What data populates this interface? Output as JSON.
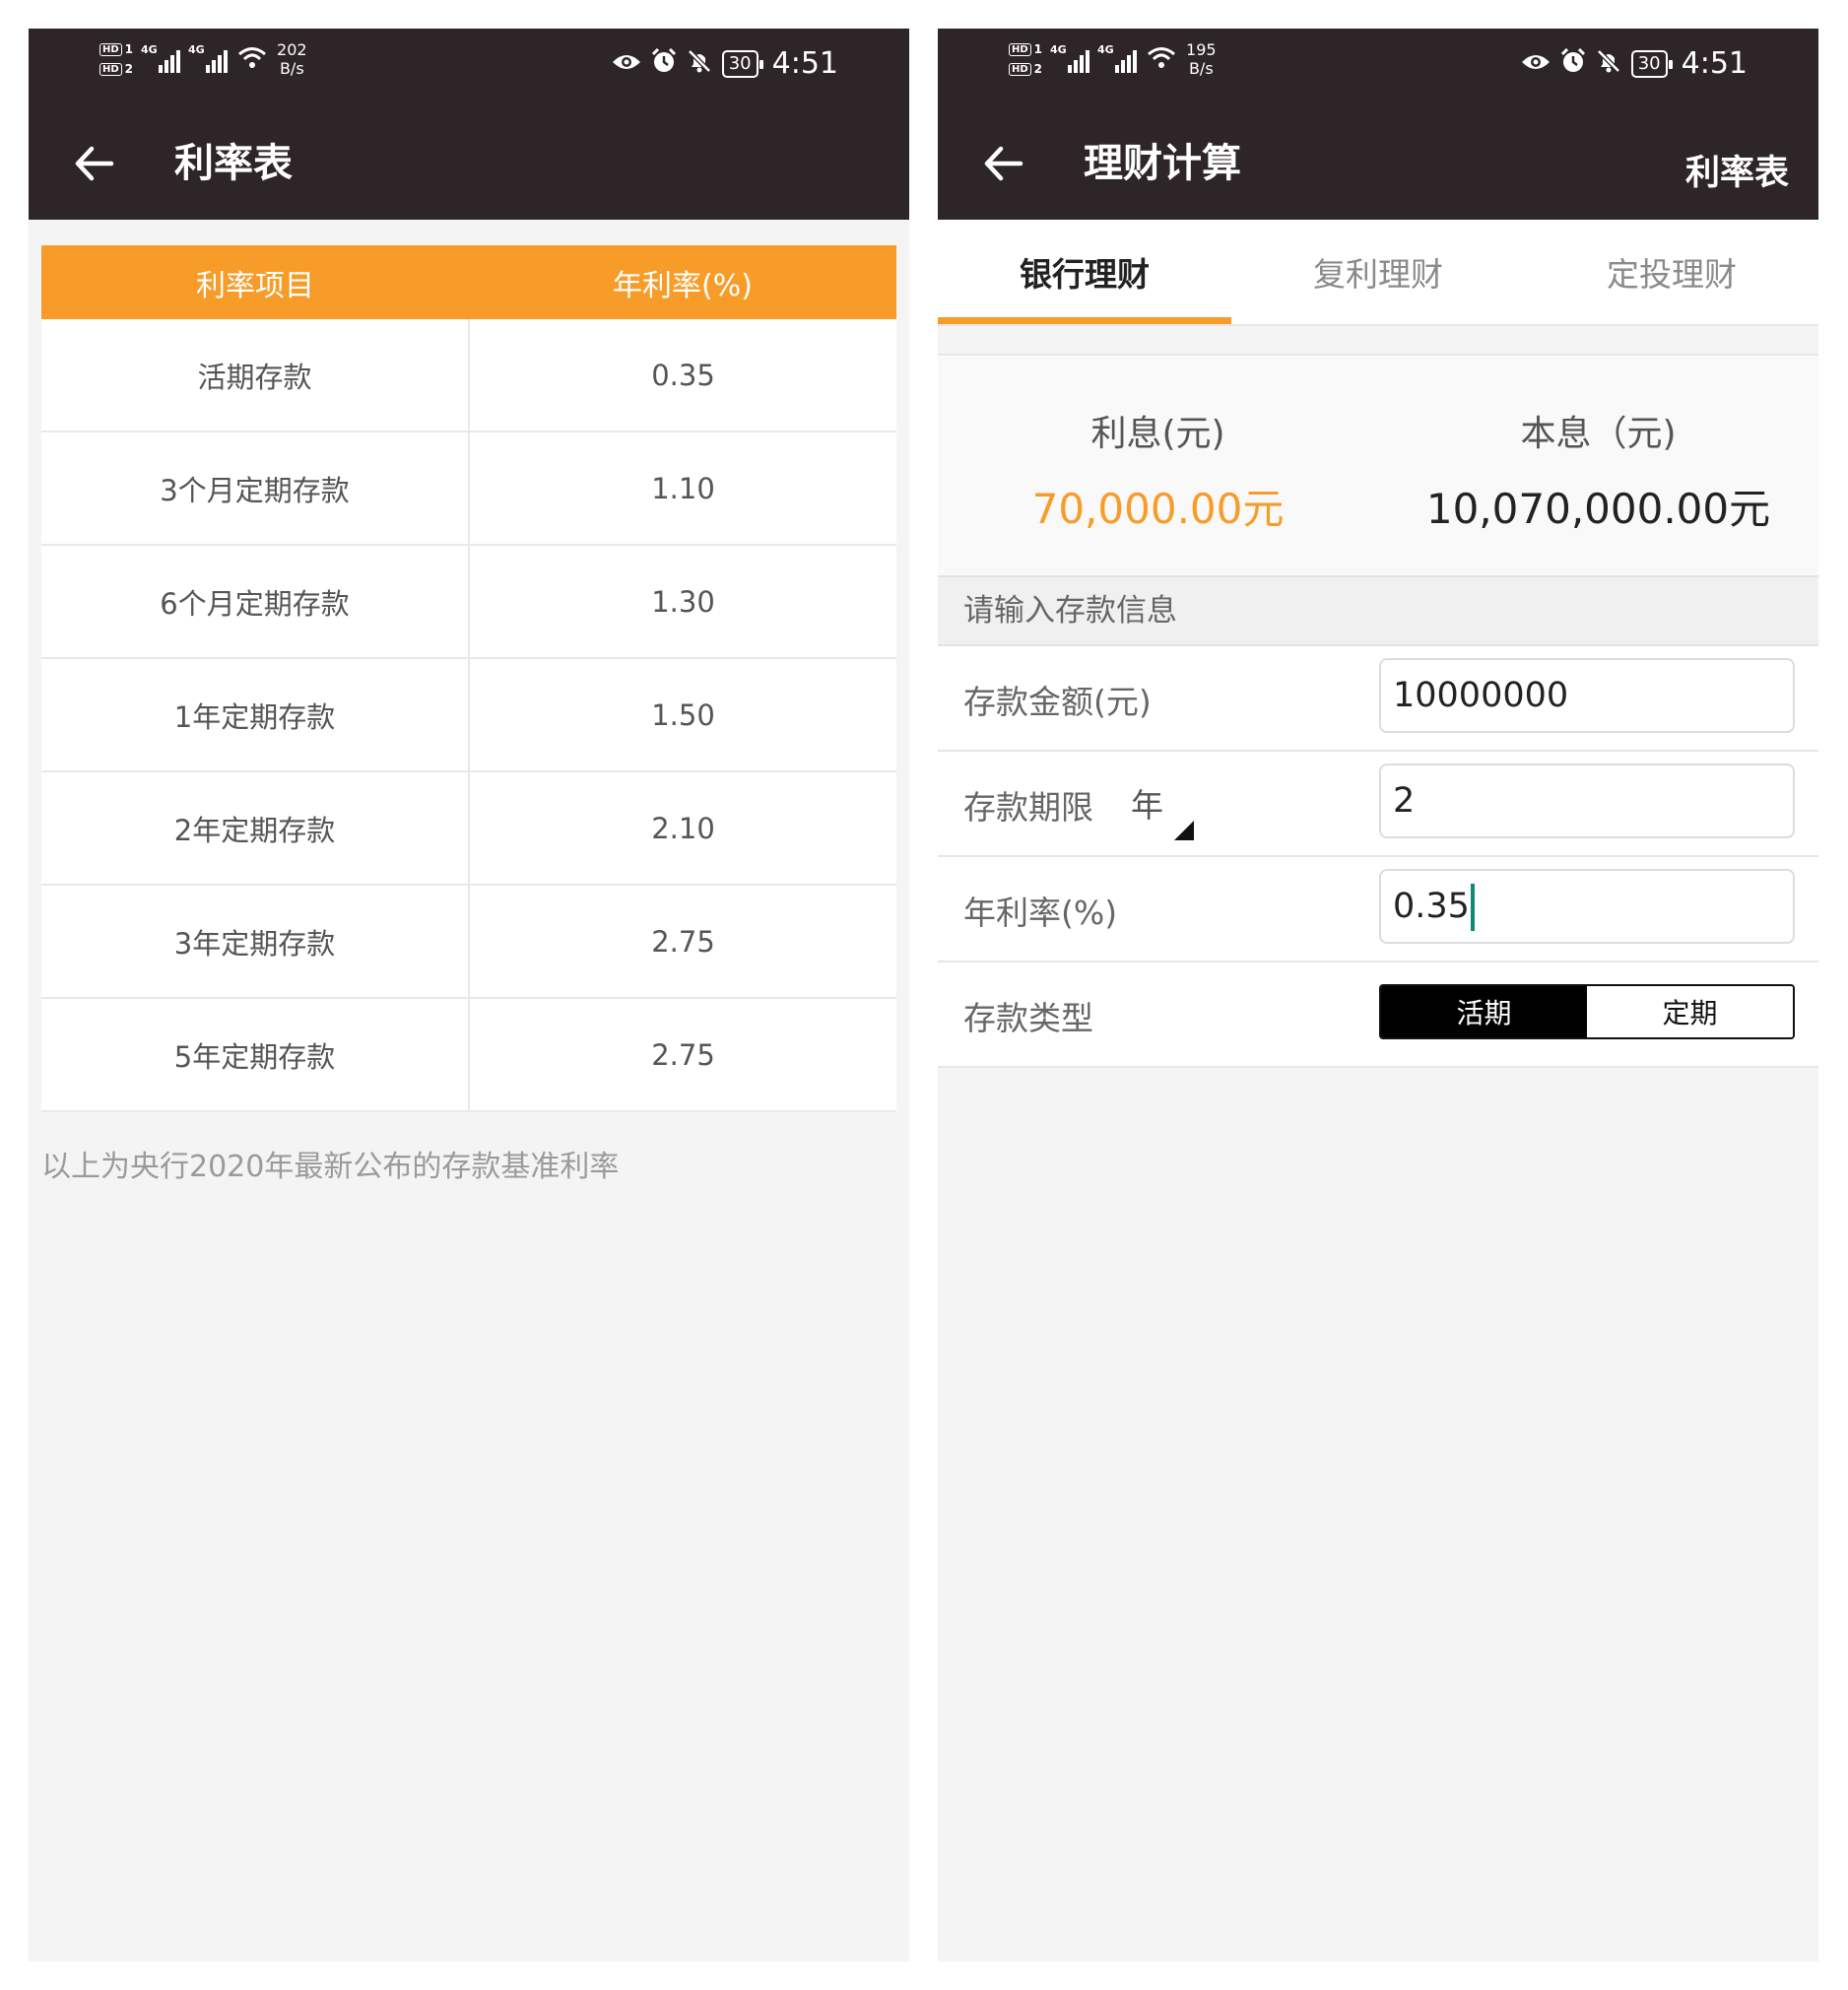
{
  "left": {
    "status": {
      "speed_value": "202",
      "speed_unit": "B/s",
      "battery": "30",
      "time": "4:51",
      "hd1": "HD",
      "hd2": "HD",
      "sim1": "1",
      "sim2": "2",
      "net1": "4G",
      "net2": "4G"
    },
    "title": "利率表",
    "table": {
      "headers": [
        "利率项目",
        "年利率(%)"
      ],
      "rows": [
        [
          "活期存款",
          "0.35"
        ],
        [
          "3个月定期存款",
          "1.10"
        ],
        [
          "6个月定期存款",
          "1.30"
        ],
        [
          "1年定期存款",
          "1.50"
        ],
        [
          "2年定期存款",
          "2.10"
        ],
        [
          "3年定期存款",
          "2.75"
        ],
        [
          "5年定期存款",
          "2.75"
        ]
      ]
    },
    "note": "以上为央行2020年最新公布的存款基准利率"
  },
  "right": {
    "status": {
      "speed_value": "195",
      "speed_unit": "B/s",
      "battery": "30",
      "time": "4:51",
      "hd1": "HD",
      "hd2": "HD",
      "sim1": "1",
      "sim2": "2",
      "net1": "4G",
      "net2": "4G"
    },
    "title": "理财计算",
    "header_link": "利率表",
    "tabs": [
      "银行理财",
      "复利理财",
      "定投理财"
    ],
    "active_tab": "银行理财",
    "results": {
      "interest_label": "利息(元)",
      "interest_value": "70,000.00元",
      "total_label": "本息（元)",
      "total_value": "10,070,000.00元"
    },
    "section_title": "请输入存款信息",
    "form": {
      "amount_label": "存款金额(元)",
      "amount_value": "10000000",
      "term_label": "存款期限",
      "term_unit": "年",
      "term_value": "2",
      "rate_label": "年利率(%)",
      "rate_value": "0.35",
      "type_label": "存款类型",
      "type_options": [
        "活期",
        "定期"
      ],
      "type_selected": "活期"
    }
  },
  "colors": {
    "accent": "#f89c29",
    "bar": "#2d2527",
    "background": "#f4f4f4"
  },
  "icons": [
    "back-arrow-icon",
    "eye-icon",
    "alarm-icon",
    "mute-bell-icon",
    "battery-icon",
    "wifi-icon",
    "signal-icon",
    "dropdown-triangle-icon"
  ]
}
